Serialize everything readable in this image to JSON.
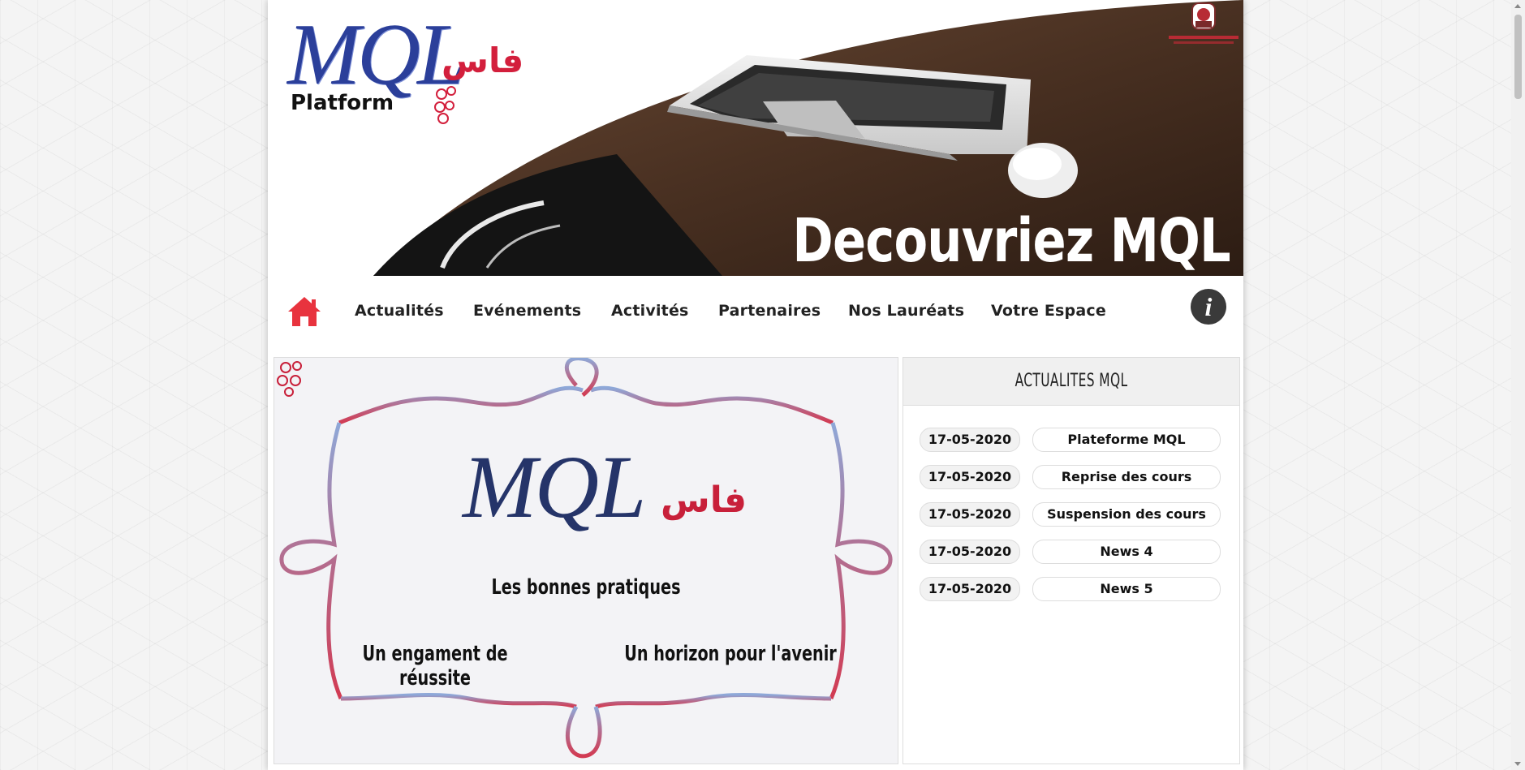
{
  "banner": {
    "logo_text": "MQL",
    "logo_platform": "Platform",
    "logo_arabic": "فاس",
    "title": "Decouvriez MQL"
  },
  "nav": {
    "home_icon": "home-icon",
    "items": [
      {
        "label": "Actualités"
      },
      {
        "label": "Evénements"
      },
      {
        "label": "Activités"
      },
      {
        "label": "Partenaires"
      },
      {
        "label": "Nos Lauréats"
      },
      {
        "label": "Votre Espace"
      }
    ],
    "info_label": "i"
  },
  "slider": {
    "logo_text": "MQL",
    "logo_arabic": "فاس",
    "subtitle": "Les bonnes pratiques",
    "left_caption": "Un engament de réussite",
    "right_caption": "Un horizon pour l'avenir"
  },
  "news": {
    "header": "ACTUALITES MQL",
    "items": [
      {
        "date": "17-05-2020",
        "title": "Plateforme MQL"
      },
      {
        "date": "17-05-2020",
        "title": "Reprise des cours"
      },
      {
        "date": "17-05-2020",
        "title": "Suspension des cours"
      },
      {
        "date": "17-05-2020",
        "title": "News 4"
      },
      {
        "date": "17-05-2020",
        "title": "News 5"
      }
    ]
  },
  "colors": {
    "brand_blue": "#2b3f9a",
    "brand_red": "#d31f3c",
    "home_red": "#e8333e"
  }
}
